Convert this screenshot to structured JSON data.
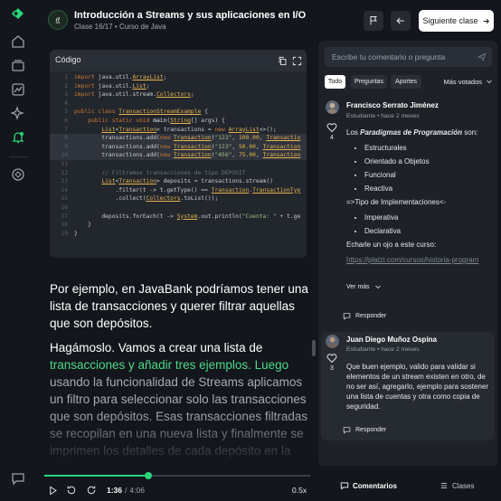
{
  "header": {
    "title": "Introducción a Streams y sus aplicaciones en I/O",
    "subtitle": "Clase 16/17 • Curso de Java",
    "next_label": "Siguiente clase"
  },
  "code": {
    "label": "Código",
    "lines": [
      {
        "n": "1",
        "html": "<span class='kw'>import</span> java.util.<span class='ty'>ArrayList</span>;"
      },
      {
        "n": "2",
        "html": "<span class='kw'>import</span> java.util.<span class='ty'>List</span>;"
      },
      {
        "n": "3",
        "html": "<span class='kw'>import</span> java.util.stream.<span class='ty'>Collectors</span>;"
      },
      {
        "n": "4",
        "html": ""
      },
      {
        "n": "5",
        "html": "<span class='kw'>public class</span> <span class='ty'>TransactionStreamExample</span> {"
      },
      {
        "n": "6",
        "html": "    <span class='kw'>public static void</span> <span class='mt'>main</span>(<span class='ty'>String</span>[] args) {"
      },
      {
        "n": "7",
        "html": "        <span class='ty'>List</span>&lt;<span class='ty'>Transaction</span>&gt; transactions = <span class='kw'>new</span> <span class='ty'>ArrayList</span>&lt;&gt;();"
      },
      {
        "n": "8",
        "html": "        transactions.add(<span class='kw'>new</span> <span class='ty'>Transaction</span>(<span class='st'>\"123\"</span>, <span class='nm'>100.00</span>, <span class='ty'>Transactio</span>",
        "hl": true
      },
      {
        "n": "9",
        "html": "        transactions.add(<span class='kw'>new</span> <span class='ty'>Transaction</span>(<span class='st'>\"123\"</span>, <span class='nm'>50.00</span>, <span class='ty'>Transaction</span>",
        "hl": true
      },
      {
        "n": "10",
        "html": "        transactions.add(<span class='kw'>new</span> <span class='ty'>Transaction</span>(<span class='st'>\"456\"</span>, <span class='nm'>75.00</span>, <span class='ty'>Transaction</span>",
        "hl": true
      },
      {
        "n": "11",
        "html": ""
      },
      {
        "n": "12",
        "html": "        <span class='cm'>// Filtramos transacciones de tipo DEPOSIT</span>"
      },
      {
        "n": "13",
        "html": "        <span class='ty'>List</span>&lt;<span class='ty'>Transaction</span>&gt; deposits = transactions.stream()"
      },
      {
        "n": "14",
        "html": "            .filter(t -&gt; t.getType() == <span class='ty'>Transaction</span>.<span class='ty'>TransactionTyp</span>"
      },
      {
        "n": "15",
        "html": "            .collect(<span class='ty'>Collectors</span>.toList());"
      },
      {
        "n": "16",
        "html": ""
      },
      {
        "n": "17",
        "html": "        deposits.forEach(t -&gt; <span class='ty'>System</span>.out.println(<span class='st'>\"Cuenta: \"</span> + t.ge"
      },
      {
        "n": "18",
        "html": "    }"
      },
      {
        "n": "19",
        "html": "}"
      }
    ]
  },
  "content": {
    "p1": "Por ejemplo, en JavaBank podríamos tener una lista de transacciones y querer filtrar aquellas que son depósitos.",
    "p2_a": "Hagámoslo. Vamos a crear una lista de",
    "p2_b": "transacciones y añadir tres ejemplos. Luego",
    "p2_c": "usando la funcionalidad de Streams aplicamos un filtro para seleccionar solo las transacciones que son depósitos. Esas transacciones filtradas se recopilan en una nueva lista y finalmente se imprimen los detalles de cada depósito en la"
  },
  "player": {
    "current": "1:36",
    "total": "4:06",
    "speed": "0.5x",
    "progress_fraction": 0.39
  },
  "comments": {
    "placeholder": "Escribe tu comentario o pregunta",
    "tabs": [
      "Todo",
      "Preguntas",
      "Aportes"
    ],
    "sort": "Más votados",
    "c1": {
      "name": "Francisco Serrato Jiménez",
      "meta": "Estudiante • hace 2 meses",
      "votes": "4",
      "intro_pre": "Los ",
      "intro_em": "Paradigmas de Programación",
      "intro_post": " son:",
      "list1": [
        "Estructurales",
        "Orientado a Objetos",
        "Funcional",
        "Reactiva"
      ],
      "impl": "=>Tipo de Implementaciones<-",
      "list2": [
        "Imperativa",
        "Declarativa"
      ],
      "outro": "Echarle un ojo a este curso:",
      "link": "https://platzi.com/cursos/historia-program",
      "see_more": "Ver más",
      "reply": "Responder"
    },
    "c2": {
      "name": "Juan Diego Muñoz Ospina",
      "meta": "Estudiante • hace 2 meses",
      "votes": "3",
      "text": "Que buen ejemplo, valido para validar si elementos de un stream existen en otro, de no ser así, agregarlo, ejemplo para sostener una lista de cuentas y otra como copia de seguridad.",
      "reply": "Responder"
    }
  },
  "bottom_tabs": {
    "comments": "Comentarios",
    "classes": "Clases"
  }
}
